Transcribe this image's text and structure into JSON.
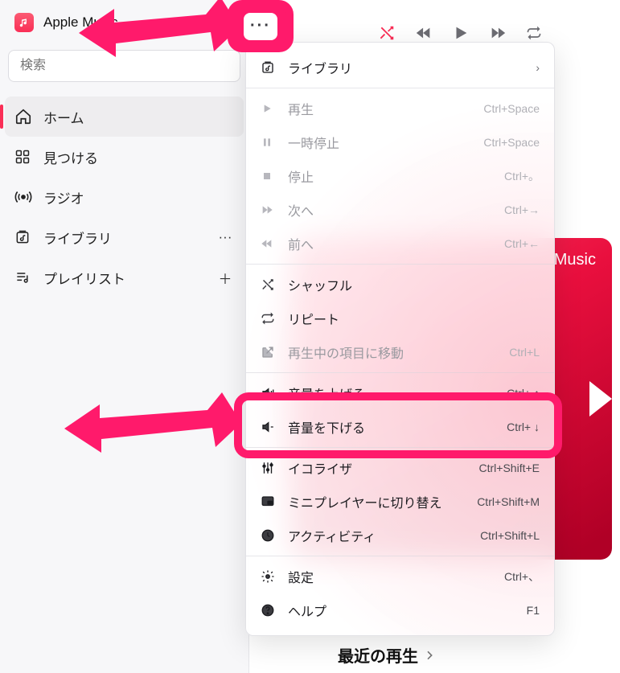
{
  "app": {
    "title": "Apple Music"
  },
  "search": {
    "placeholder": "検索"
  },
  "sidebar": {
    "items": [
      {
        "label": "ホーム",
        "icon": "home",
        "active": true
      },
      {
        "label": "見つける",
        "icon": "grid",
        "active": false
      },
      {
        "label": "ラジオ",
        "icon": "radio",
        "active": false
      },
      {
        "label": "ライブラリ",
        "icon": "library",
        "trailing": "more"
      },
      {
        "label": "プレイリスト",
        "icon": "playlist",
        "trailing": "plus"
      }
    ]
  },
  "transport": {
    "shuffle": "shuffle",
    "prev": "previous",
    "play": "play",
    "next": "next",
    "repeat": "repeat"
  },
  "menu": {
    "sections": [
      [
        {
          "label": "ライブラリ",
          "icon": "library",
          "chevron": true
        }
      ],
      [
        {
          "label": "再生",
          "icon": "play",
          "shortcut": "Ctrl+Space",
          "disabled": true
        },
        {
          "label": "一時停止",
          "icon": "pause",
          "shortcut": "Ctrl+Space",
          "disabled": true
        },
        {
          "label": "停止",
          "icon": "stop",
          "shortcut": "Ctrl+。",
          "disabled": true
        },
        {
          "label": "次へ",
          "icon": "next",
          "shortcut": "Ctrl+→",
          "disabled": true
        },
        {
          "label": "前へ",
          "icon": "prev",
          "shortcut": "Ctrl+←",
          "disabled": true
        }
      ],
      [
        {
          "label": "シャッフル",
          "icon": "shuffle"
        },
        {
          "label": "リピート",
          "icon": "repeat"
        },
        {
          "label": "再生中の項目に移動",
          "icon": "goto",
          "shortcut": "Ctrl+L",
          "disabled": true
        }
      ],
      [
        {
          "label": "音量を上げる",
          "icon": "volup",
          "shortcut": "Ctrl+ ↑"
        },
        {
          "label": "音量を下げる",
          "icon": "voldown",
          "shortcut": "Ctrl+ ↓"
        }
      ],
      [
        {
          "label": "イコライザ",
          "icon": "equalizer",
          "shortcut": "Ctrl+Shift+E"
        },
        {
          "label": "ミニプレイヤーに切り替え",
          "icon": "miniplayer",
          "shortcut": "Ctrl+Shift+M"
        },
        {
          "label": "アクティビティ",
          "icon": "activity",
          "shortcut": "Ctrl+Shift+L"
        }
      ],
      [
        {
          "label": "設定",
          "icon": "settings",
          "shortcut": "Ctrl+、"
        },
        {
          "label": "ヘルプ",
          "icon": "help",
          "shortcut": "F1"
        }
      ]
    ]
  },
  "card": {
    "text": "Music"
  },
  "recent": {
    "label": "最近の再生"
  },
  "more_button": {
    "glyph": "···"
  },
  "annotation": {
    "color": "#ff1a6b"
  }
}
